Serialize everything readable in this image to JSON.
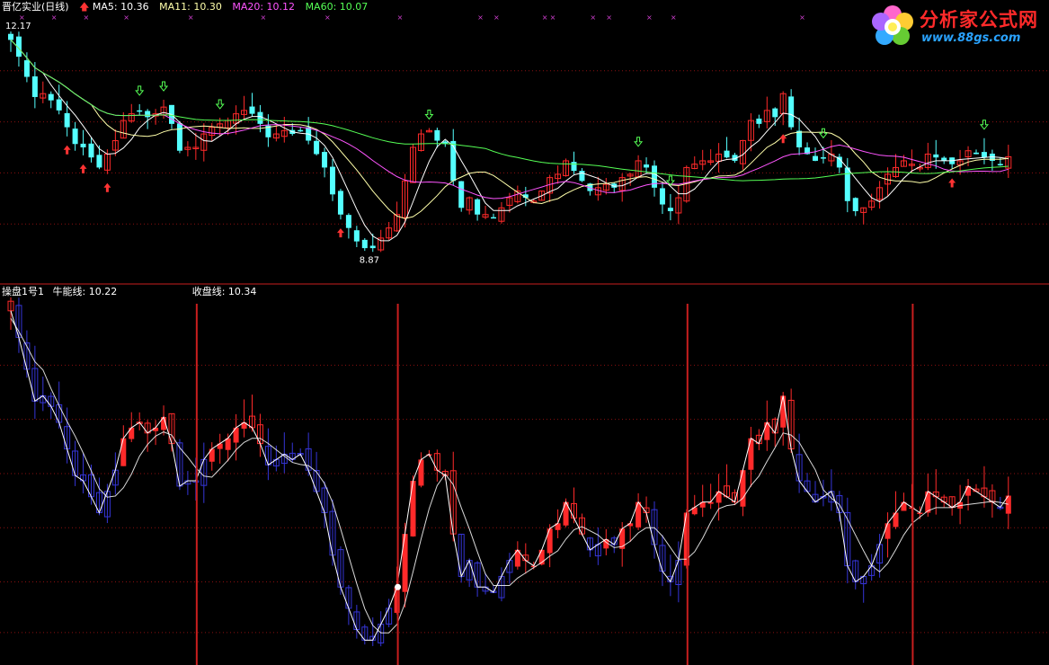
{
  "top_header": {
    "stock_name": "晋亿实业(日线)",
    "ma5": "MA5: 10.36",
    "ma11": "MA11: 10.30",
    "ma20": "MA20: 10.12",
    "ma60": "MA60: 10.07"
  },
  "bottom_header": {
    "indicator_name": "操盘1号1",
    "bull_line": "牛能线: 10.22",
    "close_line": "收盘线: 10.34"
  },
  "logo": {
    "title": "分析家公式网",
    "url": "www.88gs.com"
  },
  "colors": {
    "background": "#000000",
    "up": "#ff2a2a",
    "down": "#54ffff",
    "ma5": "#ffffff",
    "ma11": "#ffffaa",
    "ma20": "#ff55ff",
    "ma60": "#55ff55",
    "down_weak": "#3535d8",
    "separator": "#c81e1e",
    "grid": "#8a1010",
    "signal_up_arrow": "#ff3333",
    "signal_down_arrow": "#55ff55",
    "cross_marker": "#d040d0"
  },
  "chart_data": [
    {
      "type": "candlestick",
      "series": [
        {
          "name": "MA5",
          "value": 10.36
        },
        {
          "name": "MA11",
          "value": 10.3
        },
        {
          "name": "MA20",
          "value": 10.12
        },
        {
          "name": "MA60",
          "value": 10.07
        }
      ],
      "annotations": [
        {
          "text": "12.17"
        },
        {
          "text": "8.87"
        }
      ],
      "high_label": "12.17",
      "low_label": "8.87",
      "ylim": [
        8.6,
        12.4
      ],
      "grid": "horizontal dotted",
      "candles_close": [
        12.1,
        11.85,
        11.55,
        11.25,
        11.3,
        11.2,
        11.05,
        10.8,
        10.55,
        10.5,
        10.35,
        10.2,
        10.4,
        10.6,
        10.9,
        11.0,
        11.05,
        10.95,
        11.0,
        11.1,
        10.85,
        10.45,
        10.5,
        10.5,
        10.7,
        10.8,
        10.85,
        10.9,
        11.0,
        11.05,
        11.0,
        10.85,
        10.65,
        10.7,
        10.75,
        10.7,
        10.75,
        10.6,
        10.4,
        10.2,
        9.8,
        9.5,
        9.3,
        9.1,
        9.0,
        9.0,
        9.15,
        9.3,
        9.5,
        10.0,
        10.5,
        10.7,
        10.75,
        10.6,
        10.55,
        10.0,
        9.6,
        9.75,
        9.5,
        9.5,
        9.45,
        9.6,
        9.75,
        9.85,
        9.75,
        9.7,
        9.85,
        10.05,
        10.1,
        10.3,
        10.15,
        10.0,
        9.85,
        9.9,
        9.95,
        9.9,
        10.05,
        10.1,
        10.3,
        10.2,
        9.9,
        9.65,
        9.55,
        9.75,
        10.2,
        10.25,
        10.3,
        10.3,
        10.4,
        10.35,
        10.3,
        10.6,
        10.9,
        10.85,
        11.05,
        10.95,
        11.3,
        10.8,
        10.5,
        10.4,
        10.3,
        10.35,
        10.4,
        10.2,
        9.7,
        9.55,
        9.6,
        9.7,
        9.9,
        10.1,
        10.2,
        10.3,
        10.25,
        10.2,
        10.4,
        10.35,
        10.3,
        10.25,
        10.3,
        10.45,
        10.4,
        10.35,
        10.3,
        10.25,
        10.36
      ],
      "separators_at_index": [
        23,
        48,
        84,
        112
      ],
      "up_arrow_indices": [
        7,
        9,
        12,
        41,
        96,
        117
      ],
      "down_arrow_indices": [
        16,
        19,
        26,
        52,
        78,
        82,
        101,
        121,
        127
      ]
    },
    {
      "type": "line",
      "series": [
        {
          "name": "牛能线",
          "value": 10.22
        },
        {
          "name": "收盘线",
          "value": 10.34
        }
      ],
      "ylim": [
        8.8,
        12.2
      ]
    }
  ]
}
